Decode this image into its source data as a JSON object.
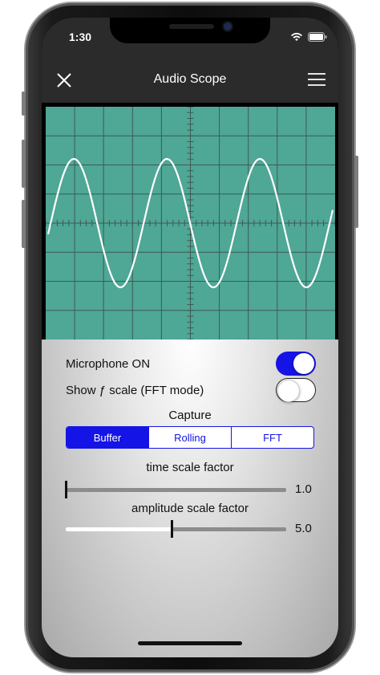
{
  "status_bar": {
    "time": "1:30"
  },
  "nav": {
    "title": "Audio Scope"
  },
  "scope": {
    "background": "#4fa796",
    "grid_color": "#3d5a54",
    "trace_color": "#ffffff"
  },
  "controls": {
    "microphone": {
      "label": "Microphone ON",
      "on": true
    },
    "fft_scale": {
      "label": "Show ƒ scale (FFT mode)",
      "on": false
    },
    "capture": {
      "label": "Capture",
      "options": [
        "Buffer",
        "Rolling",
        "FFT"
      ],
      "selected": "Buffer"
    },
    "time_scale": {
      "label": "time scale factor",
      "value": "1.0",
      "fraction": 0.0
    },
    "amplitude_scale": {
      "label": "amplitude scale factor",
      "value": "5.0",
      "fraction": 0.48
    }
  },
  "colors": {
    "accent": "#1414e6"
  }
}
